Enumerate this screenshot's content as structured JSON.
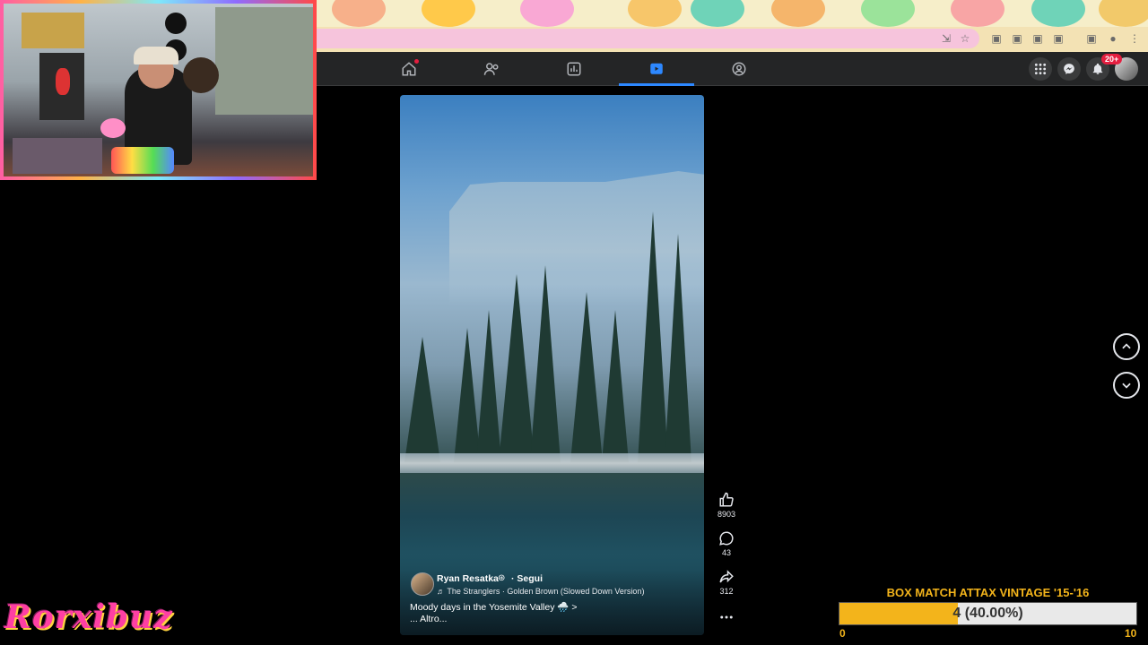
{
  "nav": {
    "tabs": [
      {
        "icon": "home-icon",
        "active": false
      },
      {
        "icon": "friends-icon",
        "active": false
      },
      {
        "icon": "dashboard-icon",
        "active": false
      },
      {
        "icon": "video-icon",
        "active": true
      },
      {
        "icon": "groups-icon",
        "active": false
      }
    ],
    "notifications_badge": "20+"
  },
  "reel": {
    "author": "Ryan Resatka",
    "follow_label": "· Segui",
    "music": "♬ The Stranglers · Golden Brown (Slowed Down Version)",
    "caption": "Moody days in the Yosemite Valley 🌧️ >",
    "more_label": "... Altro..."
  },
  "actions": {
    "likes": "8903",
    "comments": "43",
    "shares": "312"
  },
  "overlay": {
    "brand": "Rorxibuz",
    "goal": {
      "title": "BOX MATCH ATTAX VINTAGE '15-'16",
      "current": "4",
      "percent_label": "(40.00%)",
      "progress": 0.4,
      "min": "0",
      "max": "10"
    }
  },
  "colors": {
    "accent": "#2d88ff",
    "goal": "#f3b41b",
    "brand": "#ff3fa4"
  }
}
